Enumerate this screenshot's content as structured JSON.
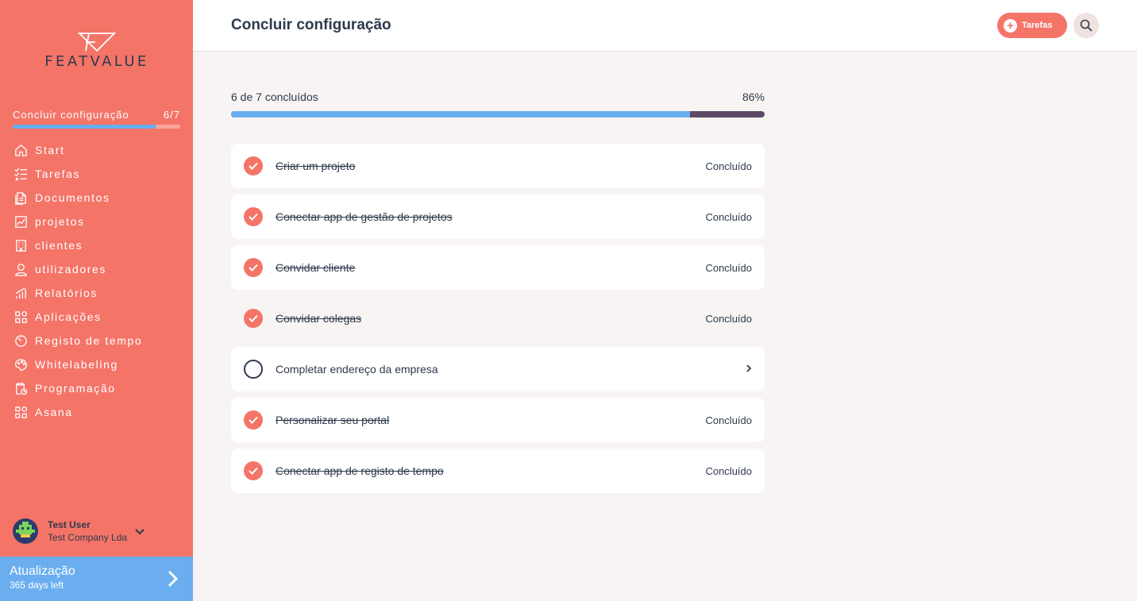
{
  "brand": {
    "name": "FEATVALUE"
  },
  "sidebar": {
    "setup": {
      "label": "Concluir configuração",
      "count": "6/7",
      "progress": 0.86
    },
    "items": [
      {
        "label": "Start",
        "icon": "home-icon"
      },
      {
        "label": "Tarefas",
        "icon": "tasks-list-icon"
      },
      {
        "label": "Documentos",
        "icon": "documents-icon"
      },
      {
        "label": "projetos",
        "icon": "projects-chart-icon"
      },
      {
        "label": "clientes",
        "icon": "building-icon"
      },
      {
        "label": "utilizadores",
        "icon": "user-icon"
      },
      {
        "label": "Relatórios",
        "icon": "reports-icon"
      },
      {
        "label": "Aplicações",
        "icon": "apps-grid-icon"
      },
      {
        "label": "Registo de tempo",
        "icon": "timer-icon"
      },
      {
        "label": "Whitelabeling",
        "icon": "palette-icon"
      },
      {
        "label": "Programação",
        "icon": "schedule-clipboard-icon"
      },
      {
        "label": "Asana",
        "icon": "apps-grid-icon"
      }
    ],
    "user": {
      "name": "Test User",
      "company": "Test Company Lda"
    },
    "upgrade": {
      "title": "Atualização",
      "subtitle": "365 days left"
    }
  },
  "header": {
    "title": "Concluir configuração",
    "tasks_button": "Tarefas"
  },
  "progress": {
    "summary": "6 de 7 concluídos",
    "percent_label": "86%",
    "value": 0.86
  },
  "tasks": [
    {
      "label": "Criar um projeto",
      "status": "Concluído",
      "done": true
    },
    {
      "label": "Conectar app de gestão de projetos",
      "status": "Concluído",
      "done": true
    },
    {
      "label": "Convidar cliente",
      "status": "Concluído",
      "done": true
    },
    {
      "label": "Convidar colegas",
      "status": "Concluído",
      "done": true
    },
    {
      "label": "Completar endereço da empresa",
      "status": "",
      "done": false
    },
    {
      "label": "Personalizar seu portal",
      "status": "Concluído",
      "done": true
    },
    {
      "label": "Conectar app de registo de tempo",
      "status": "Concluído",
      "done": true
    }
  ],
  "colors": {
    "accent": "#f47468",
    "blue": "#6aaef0",
    "dark": "#2e3a4b",
    "progress_track": "#5e4a66"
  }
}
